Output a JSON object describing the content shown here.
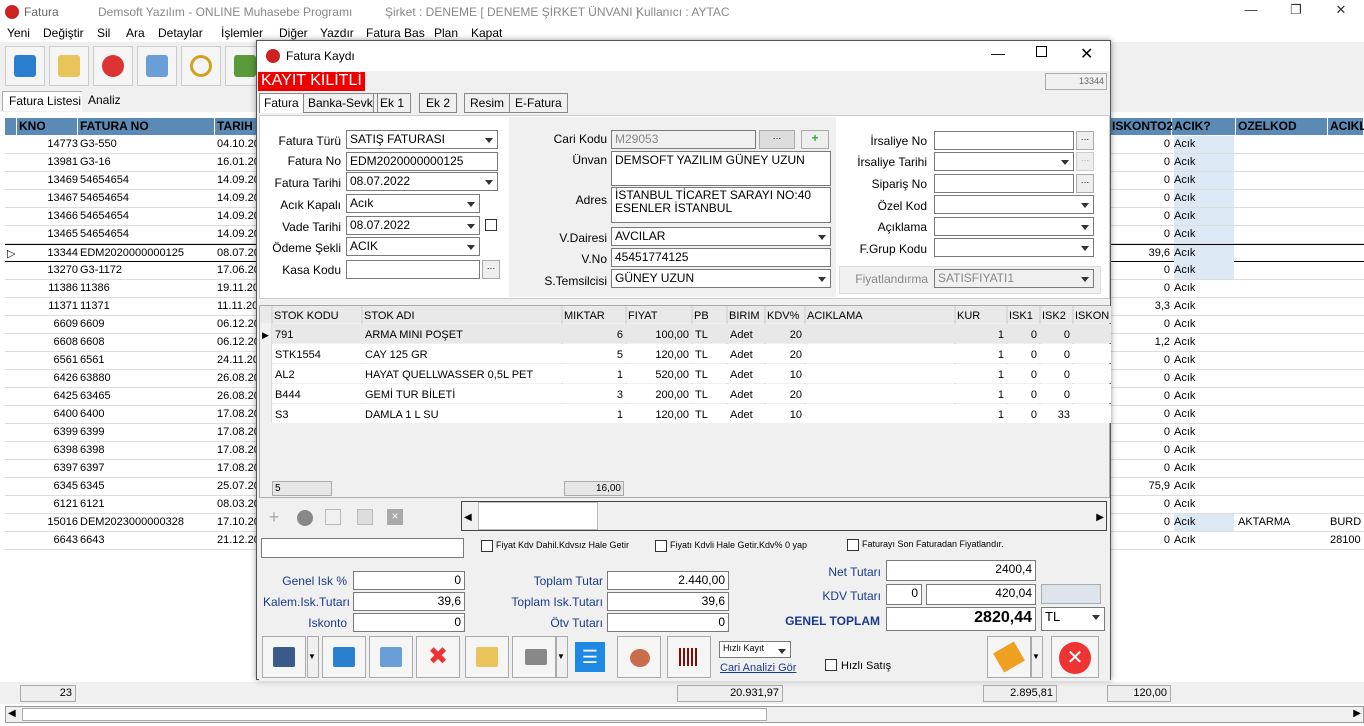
{
  "window": {
    "app_short": "Fatura",
    "app_title": "Demsoft Yazılım - ONLINE Muhasebe Programı",
    "company": "Şirket : DENEME [ DENEME ŞİRKET ÜNVANI ]",
    "user": "Kullanıcı : AYTAC"
  },
  "menu": [
    "Yeni",
    "Değiştir",
    "Sil",
    "Ara",
    "Detaylar",
    "İşlemler",
    "Diğer",
    "Yazdır",
    "Fatura Bas",
    "Plan",
    "Kapat"
  ],
  "tabs": [
    "Fatura Listesi",
    "Analiz"
  ],
  "grid": {
    "columns": [
      "KNO",
      "FATURA NO",
      "TARIH",
      "ISKONTO2",
      "ACIK?",
      "OZELKOD",
      "ACIKL"
    ],
    "rows": [
      {
        "kno": "14773",
        "no": "G3-550",
        "tarih": "04.10.20",
        "isk": "0",
        "acik": "Acık",
        "ozel": "",
        "ack": ""
      },
      {
        "kno": "13981",
        "no": "G3-16",
        "tarih": "16.01.20",
        "isk": "0",
        "acik": "Acık",
        "ozel": "",
        "ack": ""
      },
      {
        "kno": "13469",
        "no": "54654654",
        "tarih": "14.09.20",
        "isk": "0",
        "acik": "Acık",
        "ozel": "",
        "ack": ""
      },
      {
        "kno": "13467",
        "no": "54654654",
        "tarih": "14.09.20",
        "isk": "0",
        "acik": "Acık",
        "ozel": "",
        "ack": ""
      },
      {
        "kno": "13466",
        "no": "54654654",
        "tarih": "14.09.20",
        "isk": "0",
        "acik": "Acık",
        "ozel": "",
        "ack": ""
      },
      {
        "kno": "13465",
        "no": "54654654",
        "tarih": "14.09.20",
        "isk": "0",
        "acik": "Acık",
        "ozel": "",
        "ack": ""
      },
      {
        "kno": "13344",
        "no": "EDM2020000000125",
        "tarih": "08.07.20",
        "isk": "39,6",
        "acik": "Acık",
        "ozel": "",
        "ack": ""
      },
      {
        "kno": "13270",
        "no": "G3-1172",
        "tarih": "17.06.20",
        "isk": "0",
        "acik": "Acık",
        "ozel": "",
        "ack": ""
      },
      {
        "kno": "11386",
        "no": "11386",
        "tarih": "19.11.20",
        "isk": "0",
        "acik": "Acık",
        "ozel": "",
        "ack": ""
      },
      {
        "kno": "11371",
        "no": "11371",
        "tarih": "11.11.20",
        "isk": "3,3",
        "acik": "Acık",
        "ozel": "",
        "ack": ""
      },
      {
        "kno": "6609",
        "no": "6609",
        "tarih": "06.12.20",
        "isk": "0",
        "acik": "Acık",
        "ozel": "",
        "ack": ""
      },
      {
        "kno": "6608",
        "no": "6608",
        "tarih": "06.12.20",
        "isk": "1,2",
        "acik": "Acık",
        "ozel": "",
        "ack": ""
      },
      {
        "kno": "6561",
        "no": "6561",
        "tarih": "24.11.20",
        "isk": "0",
        "acik": "Acık",
        "ozel": "",
        "ack": ""
      },
      {
        "kno": "6426",
        "no": "63880",
        "tarih": "26.08.20",
        "isk": "0",
        "acik": "Acık",
        "ozel": "",
        "ack": ""
      },
      {
        "kno": "6425",
        "no": "63465",
        "tarih": "26.08.20",
        "isk": "0",
        "acik": "Acık",
        "ozel": "",
        "ack": ""
      },
      {
        "kno": "6400",
        "no": "6400",
        "tarih": "17.08.20",
        "isk": "0",
        "acik": "Acık",
        "ozel": "",
        "ack": ""
      },
      {
        "kno": "6399",
        "no": "6399",
        "tarih": "17.08.20",
        "isk": "0",
        "acik": "Acık",
        "ozel": "",
        "ack": ""
      },
      {
        "kno": "6398",
        "no": "6398",
        "tarih": "17.08.20",
        "isk": "0",
        "acik": "Acık",
        "ozel": "",
        "ack": ""
      },
      {
        "kno": "6397",
        "no": "6397",
        "tarih": "17.08.20",
        "isk": "0",
        "acik": "Acık",
        "ozel": "",
        "ack": ""
      },
      {
        "kno": "6345",
        "no": "6345",
        "tarih": "25.07.20",
        "isk": "75,9",
        "acik": "Acık",
        "ozel": "",
        "ack": ""
      },
      {
        "kno": "6121",
        "no": "6121",
        "tarih": "08.03.20",
        "isk": "0",
        "acik": "Acık",
        "ozel": "",
        "ack": ""
      },
      {
        "kno": "15016",
        "no": "DEM2023000000328",
        "tarih": "17.10.20",
        "isk": "0",
        "acik": "Acık",
        "ozel": "AKTARMA",
        "ack": "BURD"
      },
      {
        "kno": "6643",
        "no": "6643",
        "tarih": "21.12.20",
        "isk": "0",
        "acik": "Acık",
        "ozel": "",
        "ack": "28100"
      }
    ]
  },
  "footer": {
    "count": "23",
    "total1": "20.931,97",
    "total2": "2.895,81",
    "total3": "120,00"
  },
  "dialog": {
    "title": "Fatura Kaydı",
    "locked": "KAYIT KİLİTLİ",
    "record": "13344",
    "tabs": [
      "Fatura",
      "Banka-Sevk",
      "Ek 1",
      "Ek 2",
      "Resim",
      "E-Fatura"
    ],
    "left": {
      "tur_l": "Fatura Türü",
      "tur": "SATIŞ FATURASI",
      "no_l": "Fatura No",
      "no": "EDM2020000000125",
      "tarih_l": "Fatura Tarihi",
      "tarih": "08.07.2022",
      "acik_l": "Acık Kapalı",
      "acik": "Acık",
      "vade_l": "Vade Tarihi",
      "vade": "08.07.2022",
      "odeme_l": "Ödeme Şekli",
      "odeme": "ACIK",
      "kasa_l": "Kasa Kodu",
      "kasa": ""
    },
    "mid": {
      "cari_l": "Cari Kodu",
      "cari": "M29053",
      "unvan_l": "Ünvan",
      "unvan": "DEMSOFT YAZILIM GÜNEY UZUN",
      "adres_l": "Adres",
      "adres1": "İSTANBUL TİCARET SARAYI NO:40",
      "adres2": "ESENLER İSTANBUL",
      "vd_l": "V.Dairesi",
      "vd": "AVCILAR",
      "vno_l": "V.No",
      "vno": "45451774125",
      "st_l": "S.Temsilcisi",
      "st": "GÜNEY UZUN"
    },
    "right": {
      "irs_l": "İrsaliye No",
      "irst_l": "İrsaliye Tarihi",
      "sip_l": "Sipariş No",
      "ozel_l": "Özel Kod",
      "ack_l": "Açıklama",
      "fg_l": "F.Grup Kodu",
      "fiy_l": "Fiyatlandırma",
      "fiy": "SATISFIYATI1"
    },
    "lines": {
      "columns": [
        "STOK KODU",
        "STOK ADI",
        "MIKTAR",
        "FIYAT",
        "PB",
        "BIRIM",
        "KDV%",
        "ACIKLAMA",
        "KUR",
        "ISK1",
        "ISK2",
        "ISKON"
      ],
      "rows": [
        {
          "kod": "791",
          "ad": "ARMA MINI POŞET",
          "mik": "6",
          "fiy": "100,00",
          "pb": "TL",
          "bir": "Adet",
          "kdv": "20",
          "kur": "1",
          "i1": "0",
          "i2": "0"
        },
        {
          "kod": "STK1554",
          "ad": "CAY 125 GR",
          "mik": "5",
          "fiy": "120,00",
          "pb": "TL",
          "bir": "Adet",
          "kdv": "20",
          "kur": "1",
          "i1": "0",
          "i2": "0"
        },
        {
          "kod": "AL2",
          "ad": "HAYAT QUELLWASSER 0,5L PET",
          "mik": "1",
          "fiy": "520,00",
          "pb": "TL",
          "bir": "Adet",
          "kdv": "10",
          "kur": "1",
          "i1": "0",
          "i2": "0"
        },
        {
          "kod": "B444",
          "ad": "GEMİ TUR BİLETİ",
          "mik": "3",
          "fiy": "200,00",
          "pb": "TL",
          "bir": "Adet",
          "kdv": "20",
          "kur": "1",
          "i1": "0",
          "i2": "0"
        },
        {
          "kod": "S3",
          "ad": "DAMLA 1 L SU",
          "mik": "1",
          "fiy": "120,00",
          "pb": "TL",
          "bir": "Adet",
          "kdv": "10",
          "kur": "1",
          "i1": "0",
          "i2": "33"
        }
      ],
      "count": "5",
      "qty_total": "16,00"
    },
    "checks": {
      "c1": "Fiyat Kdv Dahil.Kdvsız Hale Getir",
      "c2": "Fiyatı Kdvli Hale Getir.Kdv% 0 yap",
      "c3": "Faturayı Son Faturadan Fiyatlandır."
    },
    "totals": {
      "gisk_l": "Genel Isk %",
      "gisk": "0",
      "kisk_l": "Kalem.Isk.Tutarı",
      "kisk": "39,6",
      "isk_l": "Iskonto",
      "isk": "0",
      "top_l": "Toplam Tutar",
      "top": "2.440,00",
      "topisk_l": "Toplam Isk.Tutarı",
      "topisk": "39,6",
      "otv_l": "Ötv Tutarı",
      "otv": "0",
      "net_l": "Net Tutarı",
      "net": "2400,4",
      "kdv_l": "KDV Tutarı",
      "kdv0": "0",
      "kdv": "420,04",
      "gt_l": "GENEL TOPLAM",
      "gt": "2820,44",
      "cur": "TL"
    },
    "bottom": {
      "hizli": "Hızlı Kayıt",
      "cari_analiz": "Cari Analizi Gör",
      "hizli_satis": "Hızlı Satış"
    }
  }
}
